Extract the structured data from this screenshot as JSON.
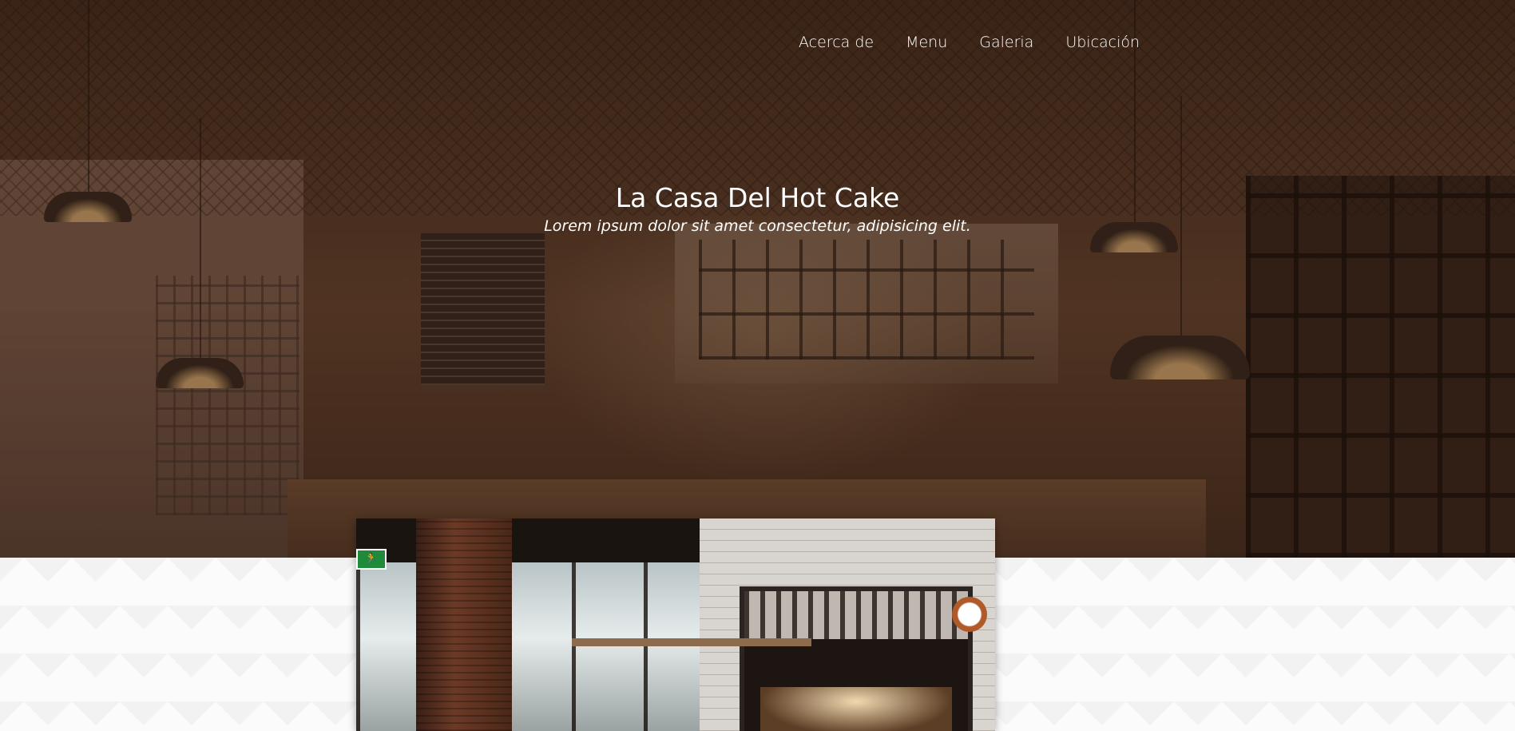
{
  "nav": {
    "items": [
      {
        "label": "Acerca de"
      },
      {
        "label": "Menu"
      },
      {
        "label": "Galeria"
      },
      {
        "label": "Ubicación"
      }
    ]
  },
  "hero": {
    "title": "La Casa Del Hot Cake",
    "subtitle": "Lorem ipsum dolor sit amet consectetur, adipisicing elit."
  },
  "colors": {
    "overlay": "#3c2314",
    "text": "#ffffff",
    "section_background": "#fbfbfb"
  }
}
